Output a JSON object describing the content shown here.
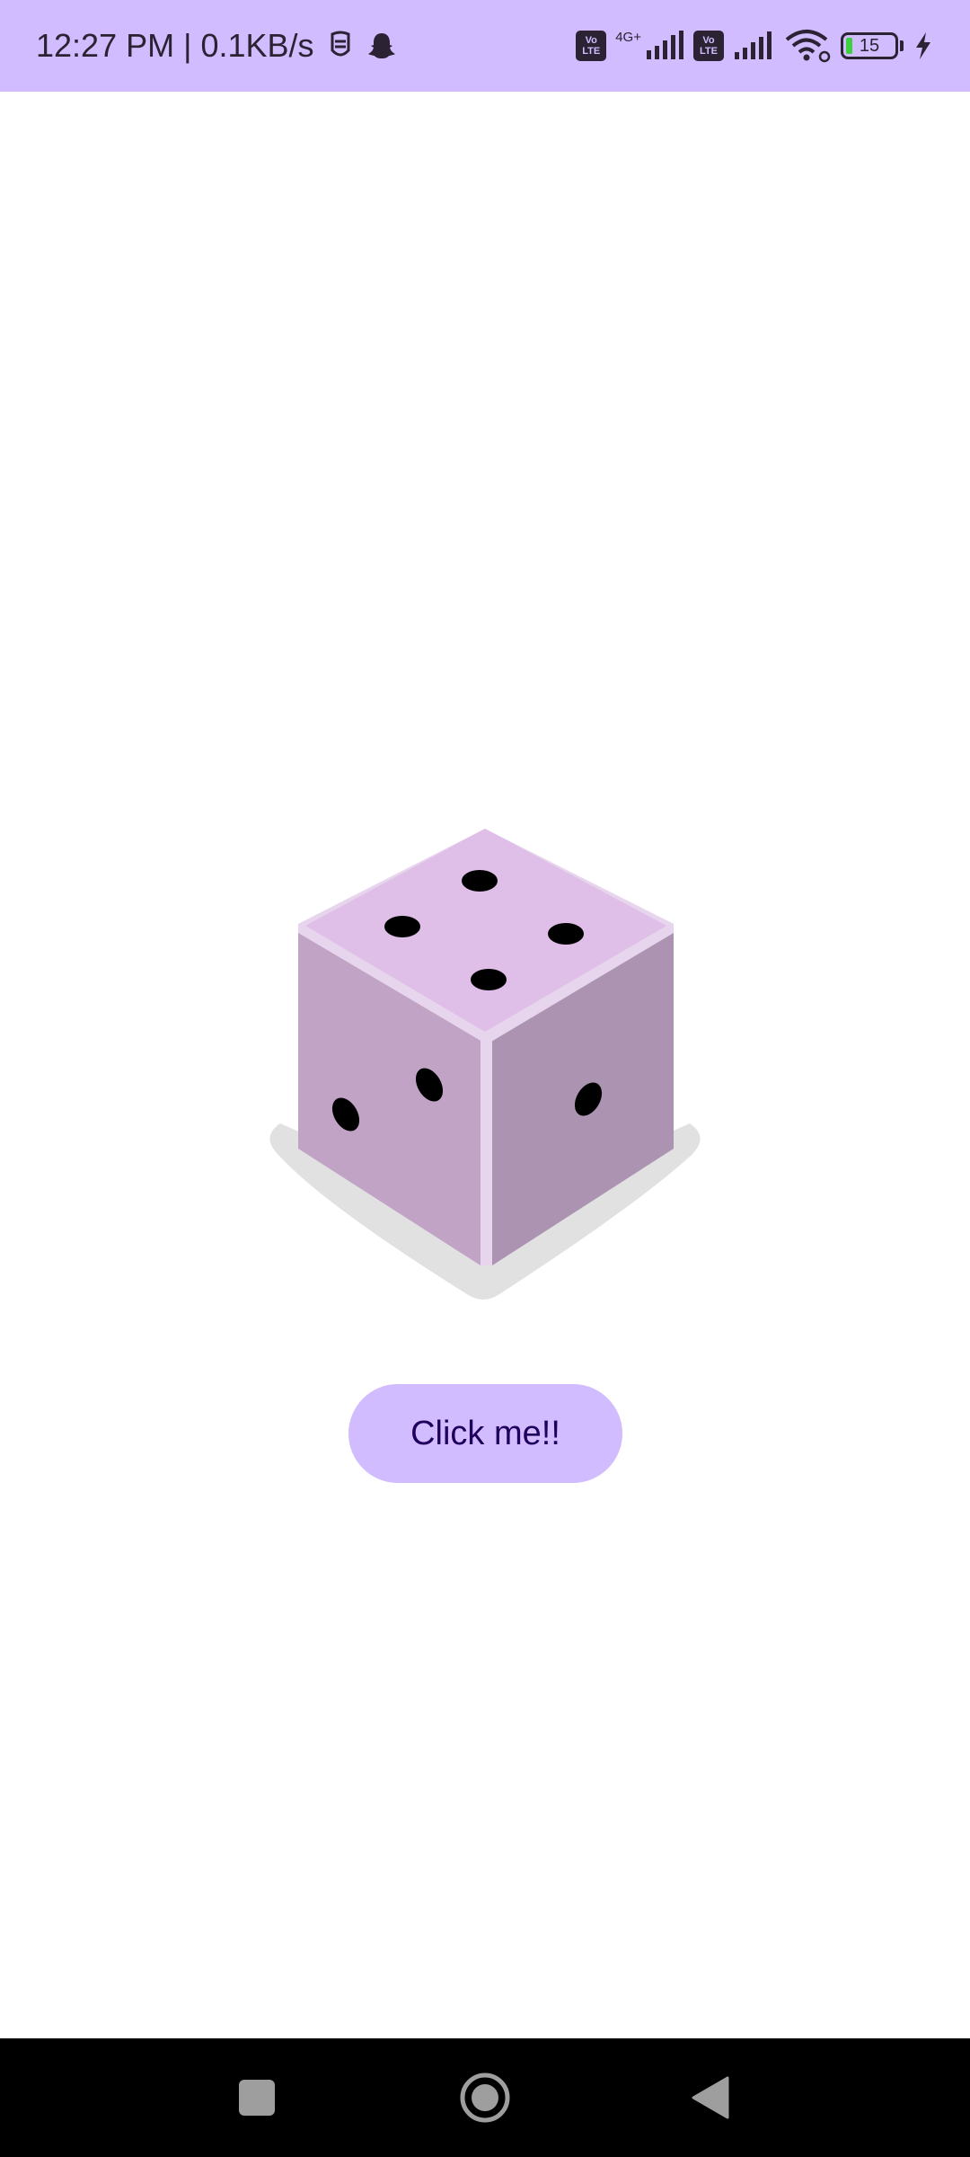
{
  "status_bar": {
    "time_speed": "12:27 PM | 0.1KB/s",
    "network_type": "4G+",
    "volte_label_top": "Vo",
    "volte_label_bottom": "LTE",
    "battery_level": "15",
    "background_color": "#d0bcff",
    "icons": [
      "face-mask-icon",
      "snapchat-ghost-icon",
      "volte-icon",
      "signal-icon",
      "wifi-icon",
      "battery-icon",
      "charging-bolt-icon"
    ]
  },
  "dice": {
    "top_face_pips": 4,
    "left_face_pips": 2,
    "right_face_pips": 1,
    "colors": {
      "top": "#dfbee8",
      "left": "#c0a3c5",
      "right": "#ab93b1",
      "edge": "#e6d5ec",
      "shadow": "#e1e1e1",
      "pip": "#000000"
    }
  },
  "roll_button": {
    "label": "Click me!!",
    "background": "#d0bcff",
    "text_color": "#21005d"
  },
  "nav_bar": {
    "icons": [
      "recents-square-icon",
      "home-circle-icon",
      "back-triangle-icon"
    ]
  }
}
